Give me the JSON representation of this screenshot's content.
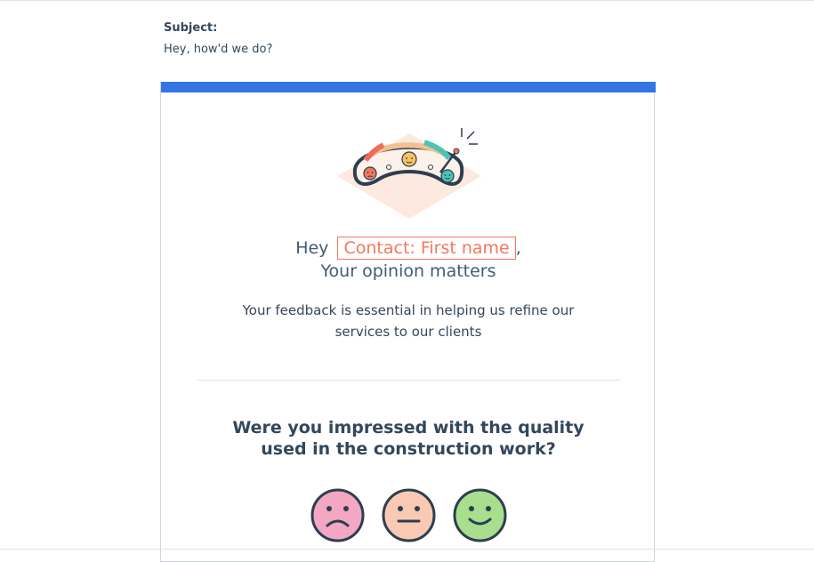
{
  "subject": {
    "label": "Subject:",
    "value": "Hey, how'd we do?"
  },
  "email": {
    "colors": {
      "accent": "#3574e3",
      "token": "#f2785c",
      "sad_face": "#f4a7c3",
      "neutral_face": "#f9c9b3",
      "happy_face": "#a8de8c"
    },
    "hero_icon": "feedback-gauge-illustration",
    "greeting_prefix": "Hey",
    "personalization_token": "Contact: First name",
    "greeting_suffix": ",",
    "subheading": "Your opinion matters",
    "body": "Your feedback is essential in helping us refine our services to our clients",
    "question": "Were you impressed with the quality used in the construction work?",
    "ratings": [
      {
        "icon": "sad-face-icon"
      },
      {
        "icon": "neutral-face-icon"
      },
      {
        "icon": "happy-face-icon"
      }
    ]
  }
}
